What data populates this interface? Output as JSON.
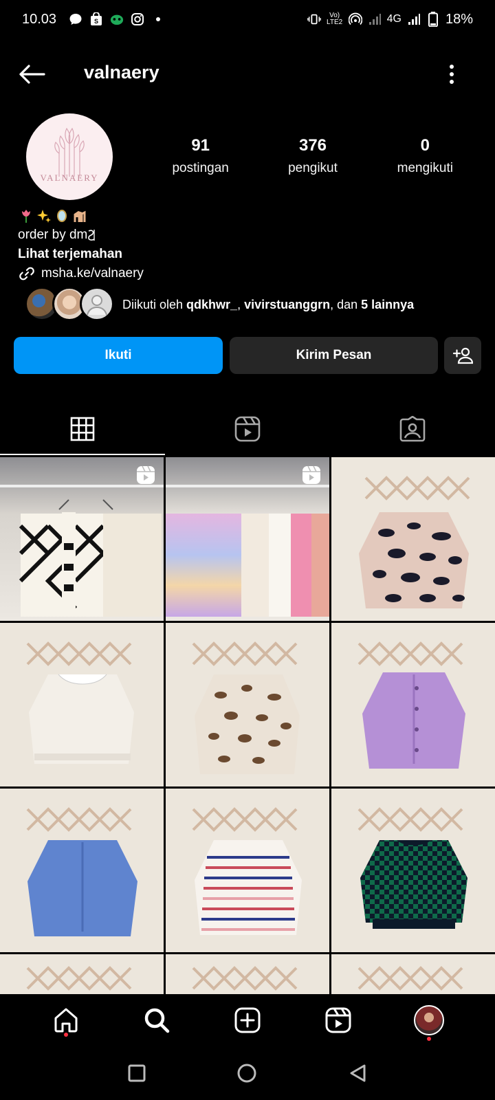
{
  "status_bar": {
    "time": "10.03",
    "network": "4G",
    "battery": "18%",
    "volte": "Vo) LTE2"
  },
  "header": {
    "username": "valnaery"
  },
  "profile": {
    "avatar_text": "VALNAERY",
    "stats": [
      {
        "value": "91",
        "label": "postingan"
      },
      {
        "value": "376",
        "label": "pengikut"
      },
      {
        "value": "0",
        "label": "mengikuti"
      }
    ],
    "bio_line": "order by dm",
    "translate_label": "Lihat terjemahan",
    "link": "msha.ke/valnaery",
    "followed_by": {
      "prefix": "Diikuti oleh ",
      "user1": "qdkhwr_",
      "sep": ", ",
      "user2": "vivirstuanggrn",
      "mid": ", dan ",
      "others": "5 lainnya"
    }
  },
  "actions": {
    "follow_label": "Ikuti",
    "message_label": "Kirim Pesan"
  },
  "tabs": [
    "grid-tab",
    "reels-tab",
    "tagged-tab"
  ],
  "colors": {
    "accent": "#0095f6",
    "button_dark": "#262626",
    "background": "#000000",
    "notification_dot": "#ff3040"
  }
}
